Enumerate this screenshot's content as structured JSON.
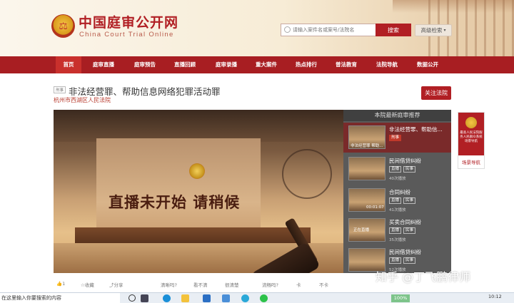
{
  "header": {
    "logo_cn": "中国庭审公开网",
    "logo_en": "China Court Trial Online",
    "search_placeholder": "请输入案件名或案号/法院名",
    "search_button": "搜索",
    "advanced_search": "高级检索"
  },
  "nav": [
    {
      "label": "首页",
      "active": true
    },
    {
      "label": "庭审直播"
    },
    {
      "label": "庭审预告"
    },
    {
      "label": "直播回顾"
    },
    {
      "label": "庭审录播"
    },
    {
      "label": "重大案件"
    },
    {
      "label": "热点排行"
    },
    {
      "label": "普法教育"
    },
    {
      "label": "法院导航"
    },
    {
      "label": "数据公开"
    }
  ],
  "case": {
    "tag": "刑事",
    "title": "非法经营罪、帮助信息网络犯罪活动罪",
    "court": "杭州市西湖区人民法院",
    "follow": "关注法院"
  },
  "video": {
    "message": "直播未开始  请稍候"
  },
  "recommend": {
    "heading": "本院最新庭审推荐",
    "items": [
      {
        "title": "非法经营罪、帮助信...",
        "tags": [
          "刑事"
        ],
        "views": "",
        "thumb_text": "非法经营罪 帮助..."
      },
      {
        "title": "民间借贷纠纷",
        "tags": [
          "直播",
          "民事"
        ],
        "views": "40次播放",
        "thumb_text": ""
      },
      {
        "title": "合同纠纷",
        "tags": [
          "直播",
          "民事"
        ],
        "views": "41次播放",
        "thumb_text": "00:01:07"
      },
      {
        "title": "买卖合同纠纷",
        "tags": [
          "直播",
          "民事"
        ],
        "views": "35次播放",
        "thumb_text": "正在直播"
      },
      {
        "title": "民间借贷纠纷",
        "tags": [
          "直播",
          "民事"
        ],
        "views": "52次播放",
        "thumb_text": ""
      }
    ]
  },
  "bottom_bar": {
    "like": "1",
    "collect": "收藏",
    "share": "分享",
    "q1": "清晰吗?",
    "opt1": "看不清",
    "opt2": "很清楚",
    "q2": "流畅吗?",
    "opt3": "卡",
    "opt4": "不卡"
  },
  "side_promo": {
    "text": "最高人民法院服务人民群众系统场景导航",
    "link": "场景导航"
  },
  "watermark": "知乎 @丁飞鹏律师",
  "taskbar": {
    "search": "在这里输入你要搜索的内容",
    "zoom": "100%",
    "time": "10:12"
  }
}
